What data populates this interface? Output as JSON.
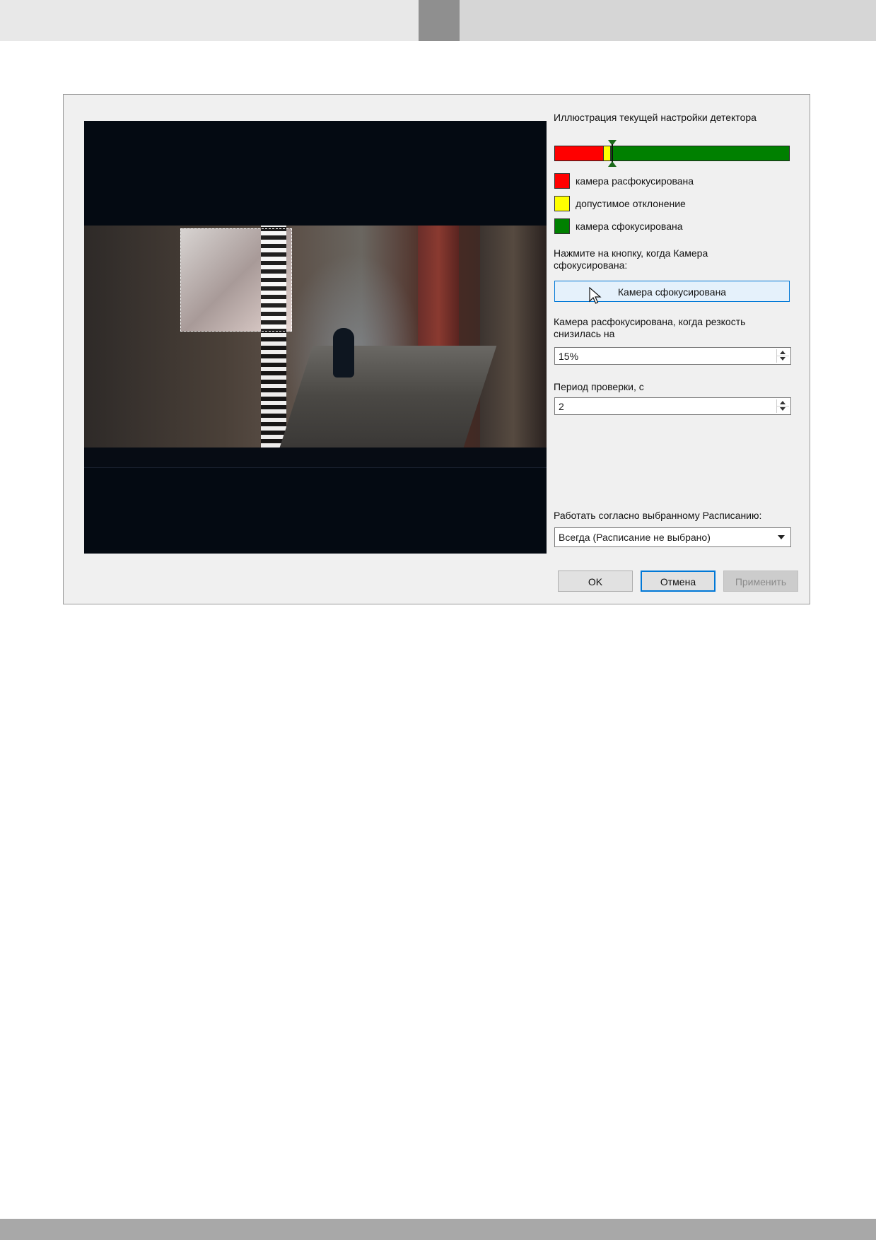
{
  "dialog": {
    "meter_title": "Иллюстрация текущей настройки детектора",
    "meter": {
      "red_fraction": 0.205,
      "yellow_fraction": 0.033,
      "marker_fraction": 0.245
    },
    "legend": [
      {
        "color": "#ff0000",
        "label": "камера расфокусирована"
      },
      {
        "color": "#ffff00",
        "label": "допустимое отклонение"
      },
      {
        "color": "#008000",
        "label": "камера сфокусирована"
      }
    ],
    "focus_prompt": "Нажмите на кнопку, когда Камера сфокусирована:",
    "focus_button": "Камера сфокусирована",
    "sharpness_label": "Камера расфокусирована, когда резкость снизилась на",
    "sharpness_value": "15%",
    "period_label": "Период проверки, с",
    "period_value": "2",
    "schedule_label": "Работать согласно выбранному Расписанию:",
    "schedule_value": "Всегда (Расписание не выбрано)",
    "buttons": {
      "ok": "OK",
      "cancel": "Отмена",
      "apply": "Применить"
    }
  },
  "colors": {
    "accent": "#0078d7",
    "focus_button_bg": "#e5f1fb"
  },
  "icons": {
    "cursor": "mouse-pointer-icon",
    "spin": "spin-arrows-icon",
    "dropdown": "chevron-down-icon"
  }
}
